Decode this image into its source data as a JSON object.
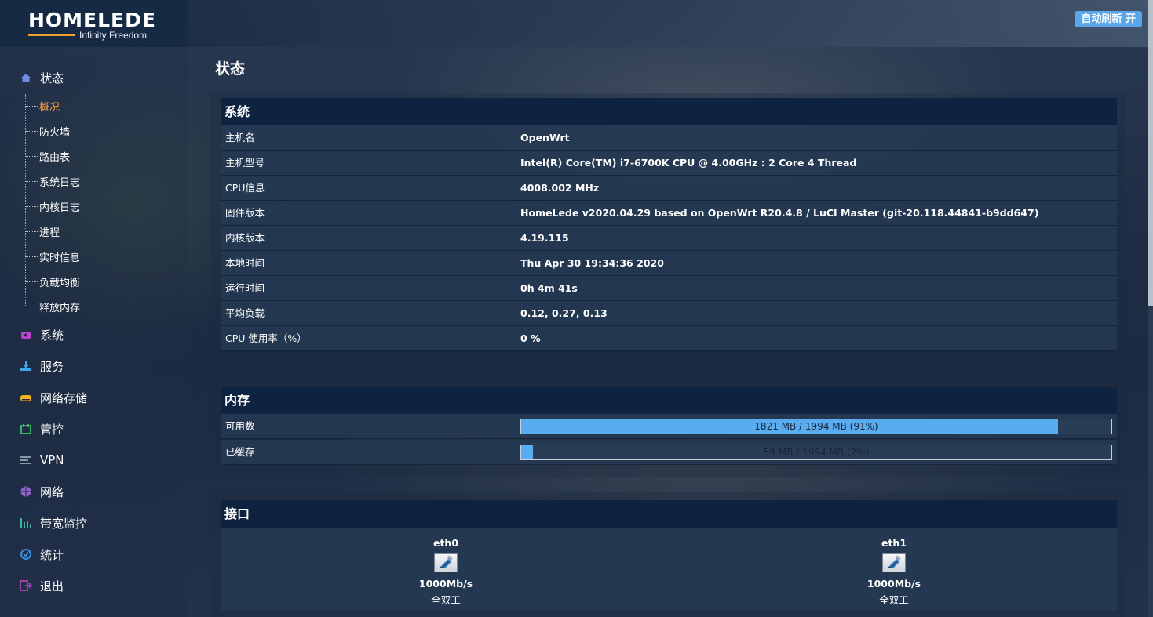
{
  "header": {
    "logo_main": "HOMELEDE",
    "logo_sub": "Infinity Freedom",
    "refresh_label": "自动刷新 开"
  },
  "sidebar": {
    "status_label": "状态",
    "sub_items": [
      "概况",
      "防火墙",
      "路由表",
      "系统日志",
      "内核日志",
      "进程",
      "实时信息",
      "负载均衡",
      "释放内存"
    ],
    "active_sub": "概况",
    "items": [
      {
        "label": "系统",
        "icon": "system-icon",
        "color": "#c040d0"
      },
      {
        "label": "服务",
        "icon": "services-icon",
        "color": "#3aa8e8"
      },
      {
        "label": "网络存储",
        "icon": "storage-icon",
        "color": "#f0b020"
      },
      {
        "label": "管控",
        "icon": "control-icon",
        "color": "#38b068"
      },
      {
        "label": "VPN",
        "icon": "vpn-icon",
        "color": "#8898a8"
      },
      {
        "label": "网络",
        "icon": "network-icon",
        "color": "#9060d0"
      },
      {
        "label": "带宽监控",
        "icon": "bandwidth-icon",
        "color": "#38b890"
      },
      {
        "label": "统计",
        "icon": "statistics-icon",
        "color": "#3a90e0"
      },
      {
        "label": "退出",
        "icon": "logout-icon",
        "color": "#a040b0"
      }
    ]
  },
  "page": {
    "title": "状态"
  },
  "system": {
    "title": "系统",
    "rows": [
      {
        "key": "主机名",
        "value": "OpenWrt"
      },
      {
        "key": "主机型号",
        "value": "Intel(R) Core(TM) i7-6700K CPU @ 4.00GHz : 2 Core 4 Thread"
      },
      {
        "key": "CPU信息",
        "value": "4008.002 MHz"
      },
      {
        "key": "固件版本",
        "value": "HomeLede v2020.04.29 based on OpenWrt R20.4.8 / LuCI Master (git-20.118.44841-b9dd647)"
      },
      {
        "key": "内核版本",
        "value": "4.19.115"
      },
      {
        "key": "本地时间",
        "value": "Thu Apr 30 19:34:36 2020"
      },
      {
        "key": "运行时间",
        "value": "0h 4m 41s"
      },
      {
        "key": "平均负载",
        "value": "0.12, 0.27, 0.13"
      },
      {
        "key": "CPU 使用率（%）",
        "value": "0 %"
      }
    ]
  },
  "memory": {
    "title": "内存",
    "rows": [
      {
        "key": "可用数",
        "text": "1821 MB / 1994 MB (91%)",
        "fraction": 0.91
      },
      {
        "key": "已缓存",
        "text": "59 MB / 1994 MB (2%)",
        "fraction": 0.02
      }
    ]
  },
  "interfaces": {
    "title": "接口",
    "items": [
      {
        "name": "eth0",
        "speed": "1000Mb/s",
        "duplex": "全双工"
      },
      {
        "name": "eth1",
        "speed": "1000Mb/s",
        "duplex": "全双工"
      }
    ]
  }
}
